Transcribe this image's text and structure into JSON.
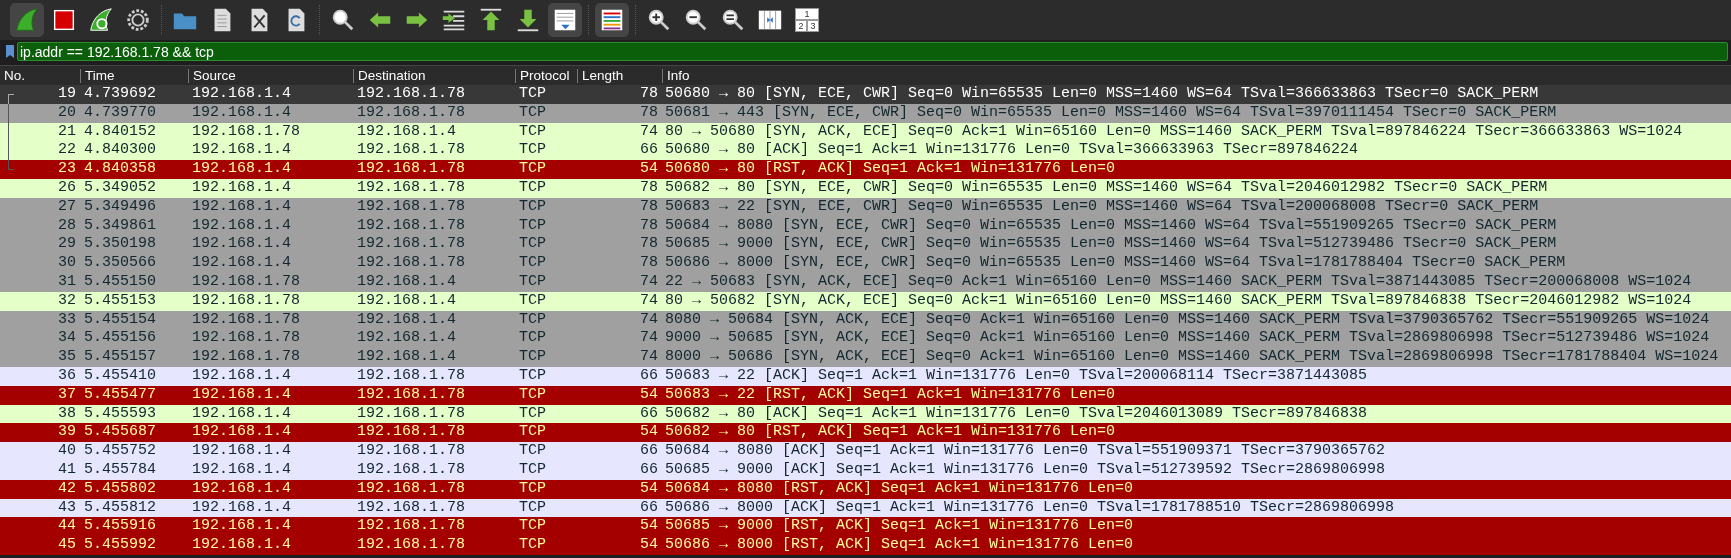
{
  "toolbar": {
    "groups": [
      [
        {
          "kind": "fin",
          "on": true
        },
        {
          "kind": "stop",
          "on": false
        },
        {
          "kind": "restart",
          "on": false
        },
        {
          "kind": "gear",
          "on": false
        }
      ],
      [
        {
          "kind": "folder",
          "on": false
        },
        {
          "kind": "file",
          "on": false
        },
        {
          "kind": "file-close",
          "on": false
        },
        {
          "kind": "file-reload",
          "on": false
        }
      ],
      [
        {
          "kind": "search",
          "on": false
        },
        {
          "kind": "left",
          "on": false
        },
        {
          "kind": "right",
          "on": false
        },
        {
          "kind": "jump",
          "on": false
        },
        {
          "kind": "first",
          "on": false
        },
        {
          "kind": "last",
          "on": false
        },
        {
          "kind": "autoscroll",
          "on": true
        }
      ],
      [
        {
          "kind": "colorize",
          "on": true
        }
      ],
      [
        {
          "kind": "zoom-in",
          "on": false
        },
        {
          "kind": "zoom-out",
          "on": false
        },
        {
          "kind": "zoom-reset",
          "on": false
        },
        {
          "kind": "resize",
          "on": false
        },
        {
          "kind": "layout",
          "on": false,
          "digits": [
            "1",
            "2",
            "3"
          ]
        }
      ]
    ]
  },
  "filter": {
    "value": "ip.addr == 192.168.1.78 && tcp"
  },
  "table": {
    "columns": [
      "No.",
      "Time",
      "Source",
      "Destination",
      "Protocol",
      "Length",
      "Info"
    ],
    "rows": [
      {
        "no": "19",
        "time": "4.739692",
        "source": "192.168.1.4",
        "destination": "192.168.1.78",
        "protocol": "TCP",
        "length": "78",
        "info": "50680 → 80 [SYN, ECE, CWR] Seq=0 Win=65535 Len=0 MSS=1460 WS=64 TSval=366633863 TSecr=0 SACK_PERM",
        "selected": true,
        "related": true
      },
      {
        "no": "20",
        "time": "4.739770",
        "source": "192.168.1.4",
        "destination": "192.168.1.78",
        "protocol": "TCP",
        "length": "78",
        "info": "50681 → 443 [SYN, ECE, CWR] Seq=0 Win=65535 Len=0 MSS=1460 WS=64 TSval=3970111454 TSecr=0 SACK_PERM",
        "kind": "gray",
        "selected": false,
        "related": true
      },
      {
        "no": "21",
        "time": "4.840152",
        "source": "192.168.1.78",
        "destination": "192.168.1.4",
        "protocol": "TCP",
        "length": "74",
        "info": "80 → 50680 [SYN, ACK, ECE] Seq=0 Ack=1 Win=65160 Len=0 MSS=1460 SACK_PERM TSval=897846224 TSecr=366633863 WS=1024",
        "kind": "green",
        "selected": false,
        "related": true
      },
      {
        "no": "22",
        "time": "4.840300",
        "source": "192.168.1.4",
        "destination": "192.168.1.78",
        "protocol": "TCP",
        "length": "66",
        "info": "50680 → 80 [ACK] Seq=1 Ack=1 Win=131776 Len=0 TSval=366633963 TSecr=897846224",
        "kind": "green",
        "selected": false,
        "related": true
      },
      {
        "no": "23",
        "time": "4.840358",
        "source": "192.168.1.4",
        "destination": "192.168.1.78",
        "protocol": "TCP",
        "length": "54",
        "info": "50680 → 80 [RST, ACK] Seq=1 Ack=1 Win=131776 Len=0",
        "kind": "red",
        "selected": false,
        "related": true
      },
      {
        "no": "26",
        "time": "5.349052",
        "source": "192.168.1.4",
        "destination": "192.168.1.78",
        "protocol": "TCP",
        "length": "78",
        "info": "50682 → 80 [SYN, ECE, CWR] Seq=0 Win=65535 Len=0 MSS=1460 WS=64 TSval=2046012982 TSecr=0 SACK_PERM",
        "kind": "green",
        "selected": false,
        "related": false
      },
      {
        "no": "27",
        "time": "5.349496",
        "source": "192.168.1.4",
        "destination": "192.168.1.78",
        "protocol": "TCP",
        "length": "78",
        "info": "50683 → 22 [SYN, ECE, CWR] Seq=0 Win=65535 Len=0 MSS=1460 WS=64 TSval=200068008 TSecr=0 SACK_PERM",
        "kind": "gray",
        "selected": false,
        "related": false
      },
      {
        "no": "28",
        "time": "5.349861",
        "source": "192.168.1.4",
        "destination": "192.168.1.78",
        "protocol": "TCP",
        "length": "78",
        "info": "50684 → 8080 [SYN, ECE, CWR] Seq=0 Win=65535 Len=0 MSS=1460 WS=64 TSval=551909265 TSecr=0 SACK_PERM",
        "kind": "gray",
        "selected": false,
        "related": false
      },
      {
        "no": "29",
        "time": "5.350198",
        "source": "192.168.1.4",
        "destination": "192.168.1.78",
        "protocol": "TCP",
        "length": "78",
        "info": "50685 → 9000 [SYN, ECE, CWR] Seq=0 Win=65535 Len=0 MSS=1460 WS=64 TSval=512739486 TSecr=0 SACK_PERM",
        "kind": "gray",
        "selected": false,
        "related": false
      },
      {
        "no": "30",
        "time": "5.350566",
        "source": "192.168.1.4",
        "destination": "192.168.1.78",
        "protocol": "TCP",
        "length": "78",
        "info": "50686 → 8000 [SYN, ECE, CWR] Seq=0 Win=65535 Len=0 MSS=1460 WS=64 TSval=1781788404 TSecr=0 SACK_PERM",
        "kind": "gray",
        "selected": false,
        "related": false
      },
      {
        "no": "31",
        "time": "5.455150",
        "source": "192.168.1.78",
        "destination": "192.168.1.4",
        "protocol": "TCP",
        "length": "74",
        "info": "22 → 50683 [SYN, ACK, ECE] Seq=0 Ack=1 Win=65160 Len=0 MSS=1460 SACK_PERM TSval=3871443085 TSecr=200068008 WS=1024",
        "kind": "gray",
        "selected": false,
        "related": false
      },
      {
        "no": "32",
        "time": "5.455153",
        "source": "192.168.1.78",
        "destination": "192.168.1.4",
        "protocol": "TCP",
        "length": "74",
        "info": "80 → 50682 [SYN, ACK, ECE] Seq=0 Ack=1 Win=65160 Len=0 MSS=1460 SACK_PERM TSval=897846838 TSecr=2046012982 WS=1024",
        "kind": "green",
        "selected": false,
        "related": false
      },
      {
        "no": "33",
        "time": "5.455154",
        "source": "192.168.1.78",
        "destination": "192.168.1.4",
        "protocol": "TCP",
        "length": "74",
        "info": "8080 → 50684 [SYN, ACK, ECE] Seq=0 Ack=1 Win=65160 Len=0 MSS=1460 SACK_PERM TSval=3790365762 TSecr=551909265 WS=1024",
        "kind": "gray",
        "selected": false,
        "related": false
      },
      {
        "no": "34",
        "time": "5.455156",
        "source": "192.168.1.78",
        "destination": "192.168.1.4",
        "protocol": "TCP",
        "length": "74",
        "info": "9000 → 50685 [SYN, ACK, ECE] Seq=0 Ack=1 Win=65160 Len=0 MSS=1460 SACK_PERM TSval=2869806998 TSecr=512739486 WS=1024",
        "kind": "gray",
        "selected": false,
        "related": false
      },
      {
        "no": "35",
        "time": "5.455157",
        "source": "192.168.1.78",
        "destination": "192.168.1.4",
        "protocol": "TCP",
        "length": "74",
        "info": "8000 → 50686 [SYN, ACK, ECE] Seq=0 Ack=1 Win=65160 Len=0 MSS=1460 SACK_PERM TSval=2869806998 TSecr=1781788404 WS=1024",
        "kind": "gray",
        "selected": false,
        "related": false
      },
      {
        "no": "36",
        "time": "5.455410",
        "source": "192.168.1.4",
        "destination": "192.168.1.78",
        "protocol": "TCP",
        "length": "66",
        "info": "50683 → 22 [ACK] Seq=1 Ack=1 Win=131776 Len=0 TSval=200068114 TSecr=3871443085",
        "kind": "lavender",
        "selected": false,
        "related": false
      },
      {
        "no": "37",
        "time": "5.455477",
        "source": "192.168.1.4",
        "destination": "192.168.1.78",
        "protocol": "TCP",
        "length": "54",
        "info": "50683 → 22 [RST, ACK] Seq=1 Ack=1 Win=131776 Len=0",
        "kind": "red",
        "selected": false,
        "related": false
      },
      {
        "no": "38",
        "time": "5.455593",
        "source": "192.168.1.4",
        "destination": "192.168.1.78",
        "protocol": "TCP",
        "length": "66",
        "info": "50682 → 80 [ACK] Seq=1 Ack=1 Win=131776 Len=0 TSval=2046013089 TSecr=897846838",
        "kind": "green",
        "selected": false,
        "related": false
      },
      {
        "no": "39",
        "time": "5.455687",
        "source": "192.168.1.4",
        "destination": "192.168.1.78",
        "protocol": "TCP",
        "length": "54",
        "info": "50682 → 80 [RST, ACK] Seq=1 Ack=1 Win=131776 Len=0",
        "kind": "red",
        "selected": false,
        "related": false
      },
      {
        "no": "40",
        "time": "5.455752",
        "source": "192.168.1.4",
        "destination": "192.168.1.78",
        "protocol": "TCP",
        "length": "66",
        "info": "50684 → 8080 [ACK] Seq=1 Ack=1 Win=131776 Len=0 TSval=551909371 TSecr=3790365762",
        "kind": "lavender",
        "selected": false,
        "related": false
      },
      {
        "no": "41",
        "time": "5.455784",
        "source": "192.168.1.4",
        "destination": "192.168.1.78",
        "protocol": "TCP",
        "length": "66",
        "info": "50685 → 9000 [ACK] Seq=1 Ack=1 Win=131776 Len=0 TSval=512739592 TSecr=2869806998",
        "kind": "lavender",
        "selected": false,
        "related": false
      },
      {
        "no": "42",
        "time": "5.455802",
        "source": "192.168.1.4",
        "destination": "192.168.1.78",
        "protocol": "TCP",
        "length": "54",
        "info": "50684 → 8080 [RST, ACK] Seq=1 Ack=1 Win=131776 Len=0",
        "kind": "red",
        "selected": false,
        "related": false
      },
      {
        "no": "43",
        "time": "5.455812",
        "source": "192.168.1.4",
        "destination": "192.168.1.78",
        "protocol": "TCP",
        "length": "66",
        "info": "50686 → 8000 [ACK] Seq=1 Ack=1 Win=131776 Len=0 TSval=1781788510 TSecr=2869806998",
        "kind": "lavender",
        "selected": false,
        "related": false
      },
      {
        "no": "44",
        "time": "5.455916",
        "source": "192.168.1.4",
        "destination": "192.168.1.78",
        "protocol": "TCP",
        "length": "54",
        "info": "50685 → 9000 [RST, ACK] Seq=1 Ack=1 Win=131776 Len=0",
        "kind": "red",
        "selected": false,
        "related": false
      },
      {
        "no": "45",
        "time": "5.455992",
        "source": "192.168.1.4",
        "destination": "192.168.1.78",
        "protocol": "TCP",
        "length": "54",
        "info": "50686 → 8000 [RST, ACK] Seq=1 Ack=1 Win=131776 Len=0",
        "kind": "red",
        "selected": false,
        "related": false
      }
    ]
  }
}
